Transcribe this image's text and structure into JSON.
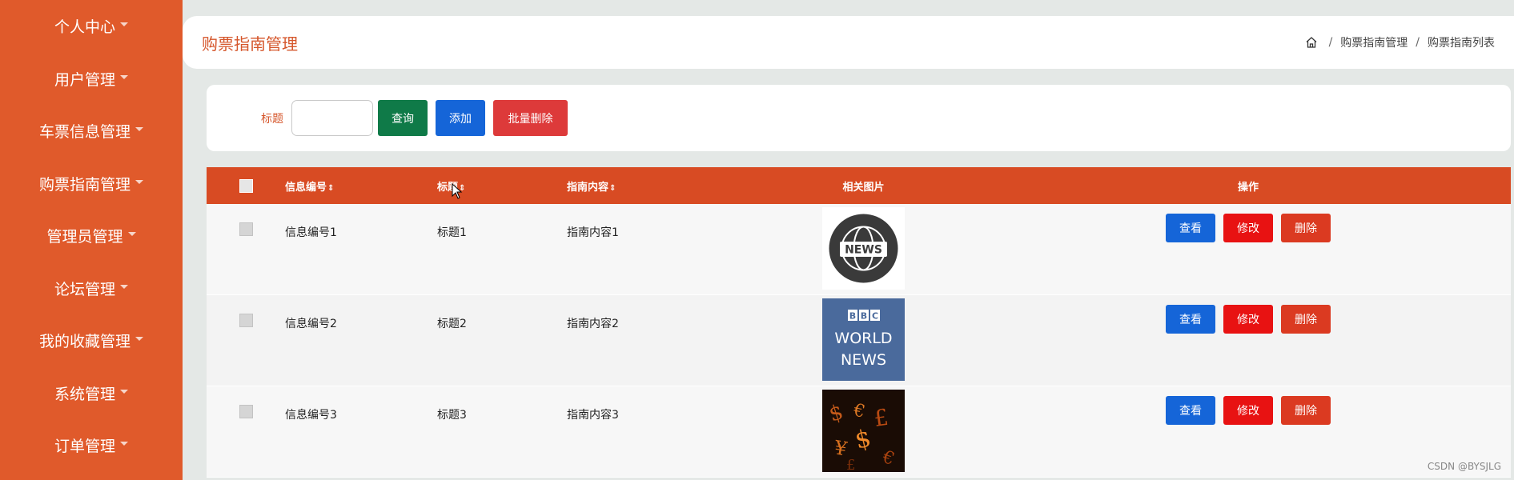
{
  "sidebar": {
    "items": [
      {
        "label": "个人中心"
      },
      {
        "label": "用户管理"
      },
      {
        "label": "车票信息管理"
      },
      {
        "label": "购票指南管理"
      },
      {
        "label": "管理员管理"
      },
      {
        "label": "论坛管理"
      },
      {
        "label": "我的收藏管理"
      },
      {
        "label": "系统管理"
      },
      {
        "label": "订单管理"
      }
    ]
  },
  "header": {
    "title": "购票指南管理",
    "breadcrumb": [
      "购票指南管理",
      "购票指南列表"
    ],
    "breadcrumb_sep": "/"
  },
  "search": {
    "label": "标题",
    "value": "",
    "query_label": "查询",
    "add_label": "添加",
    "batch_delete_label": "批量删除"
  },
  "table": {
    "columns": {
      "id": "信息编号",
      "title": "标题",
      "content": "指南内容",
      "picture": "相关图片",
      "actions": "操作"
    },
    "sort_icon": "⇕",
    "rows": [
      {
        "id": "信息编号1",
        "title": "标题1",
        "content": "指南内容1",
        "picture_icon": "news-globe-image"
      },
      {
        "id": "信息编号2",
        "title": "标题2",
        "content": "指南内容2",
        "picture_icon": "bbc-world-news-image",
        "picture_text": [
          "BBC",
          "WORLD",
          "NEWS"
        ]
      },
      {
        "id": "信息编号3",
        "title": "标题3",
        "content": "指南内容3",
        "picture_icon": "currency-symbols-image"
      }
    ],
    "actions": {
      "view": "查看",
      "edit": "修改",
      "delete": "删除"
    }
  },
  "watermark": "CSDN @BYSJLG",
  "colors": {
    "sidebar": "#e05a2b",
    "accent": "#d5562b",
    "table_header": "#d84b23",
    "query": "#0f7a48",
    "add": "#1565d8",
    "edit": "#e81212",
    "delete": "#db3a21"
  }
}
